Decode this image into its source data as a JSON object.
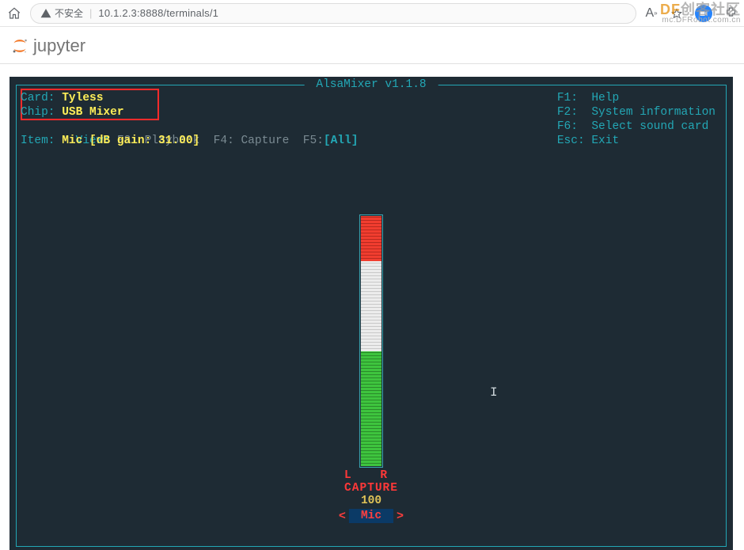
{
  "browser": {
    "insecure_label": "不安全",
    "url": "10.1.2.3:8888/terminals/1"
  },
  "watermark": {
    "brand_df": "DF",
    "brand_rest": "创客社区",
    "sub": "mc.DFRobot.com.cn"
  },
  "jupyter": {
    "name": "jupyter"
  },
  "term": {
    "title": " AlsaMixer v1.1.8 ",
    "card_label": "Card: ",
    "card_value": "Tyless",
    "chip_label": "Chip: ",
    "chip_value": "USB Mixer",
    "view_prefix": "View: ",
    "view_f3": "F3: Playback",
    "view_f4": "F4: Capture",
    "view_f5_key": "F5:",
    "view_f5_val": "[All]",
    "item_label": "Item: ",
    "item_value": "Mic [dB gain: 31.00]",
    "help": {
      "f1k": "F1:  ",
      "f1v": "Help",
      "f2k": "F2:  ",
      "f2v": "System information",
      "f6k": "F6:  ",
      "f6v": "Select sound card",
      "esck": "Esc: ",
      "escv": "Exit"
    },
    "mixer": {
      "green_pct": 46,
      "white_pct": 36,
      "red_pct": 18,
      "empty_pct": 0,
      "lr": "L R",
      "capture": "CAPTURE",
      "value": "100",
      "arrow_l": "<",
      "arrow_r": ">",
      "chip_name": "Mic"
    }
  }
}
